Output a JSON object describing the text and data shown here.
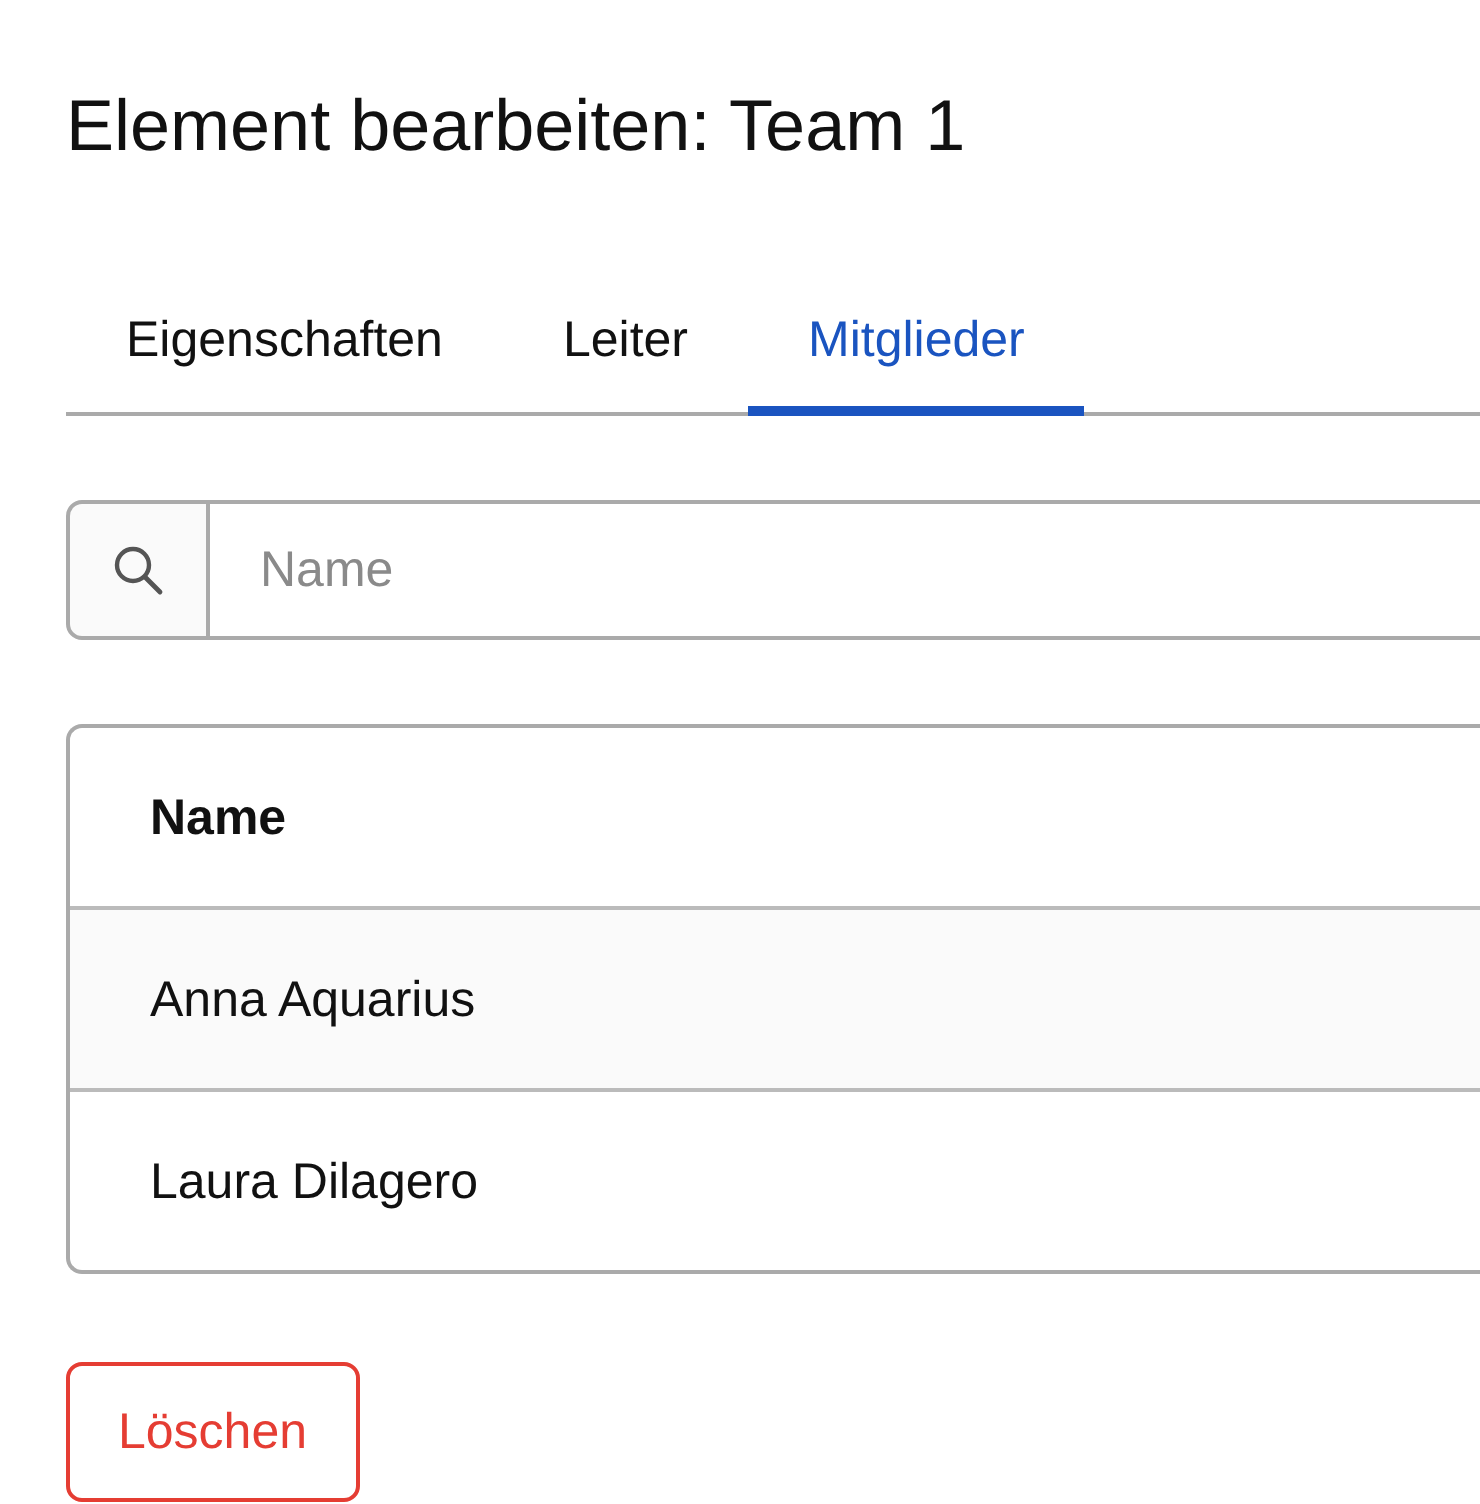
{
  "title": "Element bearbeiten: Team 1",
  "tabs": [
    {
      "label": "Eigenschaften",
      "selected": false
    },
    {
      "label": "Leiter",
      "selected": false
    },
    {
      "label": "Mitglieder",
      "selected": true
    }
  ],
  "search": {
    "placeholder": "Name"
  },
  "table": {
    "columns": [
      "Name"
    ],
    "rows": [
      [
        "Anna Aquarius"
      ],
      [
        "Laura Dilagero"
      ]
    ]
  },
  "buttons": [
    {
      "label": "Löschen",
      "kind": "danger"
    }
  ]
}
